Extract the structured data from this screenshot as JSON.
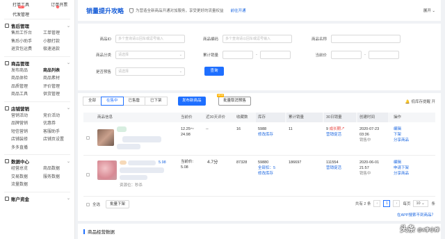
{
  "sidebar": {
    "top": {
      "orders": "打单工具",
      "orders_badge": "HOT",
      "invoice": "订单开票",
      "invoice_badge": "1",
      "delivery": "代发管理"
    },
    "groups": [
      {
        "title": "售后管理",
        "items": [
          "售后工作台",
          "工单管理",
          "售后小助手",
          "小额打款",
          "退货包运费",
          "极速退款"
        ]
      },
      {
        "title": "商品管理",
        "items": [
          "发布商品",
          "商品列表",
          "商品体检",
          "商品素材",
          "品质管理",
          "评价管理",
          "商品工具",
          "供货管理"
        ]
      },
      {
        "title": "店铺营销",
        "items": [
          "营销活动",
          "竞价活动",
          "品牌营销",
          "优惠券",
          "短信营销",
          "客服助手",
          "店铺装修",
          "店铺页设置",
          "多多直播"
        ]
      },
      {
        "title": "数据中心",
        "items": [
          "经营总览",
          "商品数据",
          "交易数据",
          "服务数据",
          "流量数据"
        ]
      },
      {
        "title": "账户资金",
        "items": []
      }
    ]
  },
  "banner": {
    "title": "销量提升攻略",
    "desc": "为营造全新商品开通对加服务，享受更好的流量权益",
    "link": "前往开通",
    "more": "展开"
  },
  "filter": {
    "goods_id": {
      "label": "商品ID",
      "placeholder": "多个查询请以回车或逗号输入"
    },
    "goods_code": {
      "label": "商品编码",
      "placeholder": "多个查询请以回车或逗号输入"
    },
    "goods_name": {
      "label": "商品名称",
      "placeholder": ""
    },
    "category": {
      "label": "商品分类",
      "placeholder": "请选择"
    },
    "sales": {
      "label": "累计销量",
      "sep": "-"
    },
    "price": {
      "label": "当前价",
      "sep": "-"
    },
    "presale": {
      "label": "是否预售",
      "placeholder": "请选择"
    },
    "query_btn": "查询"
  },
  "listing": {
    "tabs": [
      "全部",
      "在售中",
      "已售罄",
      "已下架"
    ],
    "active_tab": 1,
    "publish_btn": "发布新商品",
    "cancel_presale_btn": "批量取消预售",
    "cancel_presale_badge": "NEW",
    "stock_alert": "低库存提醒",
    "stock_alert_switch": "开",
    "columns": [
      "商品信息",
      "当前价",
      "近30天评价",
      "收藏数",
      "库存",
      "累计销量",
      "30日销量",
      "创建时间",
      "操作"
    ],
    "rows": [
      {
        "price": "12.25～24.98",
        "rating": "--",
        "favorites": "16",
        "stock": "5988",
        "stock_action": "修改库存",
        "total_sales": "11",
        "sales30": "9",
        "sales30_trend": "成长期",
        "sales30_action": "营销促活",
        "created": "2020-07-23 03:36",
        "status": "销售中",
        "actions": [
          "编辑",
          "下架",
          "分享商品"
        ]
      },
      {
        "price_label": "当前价:",
        "price": "5.08",
        "rating": "4.7分",
        "favorites": "87328",
        "stock": "59880",
        "stock_extra": "全部扣：5",
        "stock_action": "修改库存",
        "total_sales": "186697",
        "sales30": "111554",
        "sales30_action": "营销促活",
        "created": "2020-06-01 21:57",
        "status": "销售中",
        "actions": [
          "编辑",
          "申请下架",
          "分享商品"
        ],
        "goods_price_tag": "5.98",
        "source_tag": "资源位：秒杀"
      }
    ],
    "footer": {
      "select_all": "全选",
      "batch_off": "批量下架",
      "total": "共有 2 条",
      "per_page_label": "每页",
      "page": "1",
      "page_size": "10",
      "per_unit": "条"
    },
    "help_link": "在APP搜索不到商品？"
  },
  "bottom": {
    "title": "商品经营数据"
  },
  "watermark": {
    "text": "头条",
    "handle": "@a李小烨"
  },
  "colors": {
    "accent": "#1e6fff",
    "title": "#1a5fd8",
    "warning": "#e53935"
  }
}
